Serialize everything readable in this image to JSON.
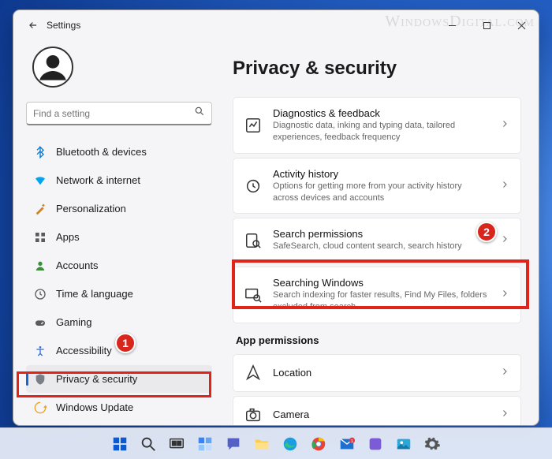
{
  "watermark": "WindowsDigital.com",
  "window": {
    "title": "Settings"
  },
  "search": {
    "placeholder": "Find a setting"
  },
  "sidebar": {
    "items": [
      {
        "label": "Bluetooth & devices",
        "icon": "bluetooth",
        "color": "#0078d4"
      },
      {
        "label": "Network & internet",
        "icon": "wifi",
        "color": "#00a4ef"
      },
      {
        "label": "Personalization",
        "icon": "brush",
        "color": "#c8852c"
      },
      {
        "label": "Apps",
        "icon": "apps",
        "color": "#5b5b5b"
      },
      {
        "label": "Accounts",
        "icon": "person",
        "color": "#3a8f3a"
      },
      {
        "label": "Time & language",
        "icon": "clock",
        "color": "#5b5b5b"
      },
      {
        "label": "Gaming",
        "icon": "game",
        "color": "#5b5b5b"
      },
      {
        "label": "Accessibility",
        "icon": "access",
        "color": "#2e6fd0"
      },
      {
        "label": "Privacy & security",
        "icon": "shield",
        "color": "#7a7f86",
        "active": true
      },
      {
        "label": "Windows Update",
        "icon": "update",
        "color": "#f0a020"
      }
    ]
  },
  "main": {
    "heading": "Privacy & security",
    "cards": [
      {
        "icon": "diag",
        "title": "Diagnostics & feedback",
        "subtitle": "Diagnostic data, inking and typing data, tailored experiences, feedback frequency"
      },
      {
        "icon": "activity",
        "title": "Activity history",
        "subtitle": "Options for getting more from your activity history across devices and accounts"
      },
      {
        "icon": "searchperm",
        "title": "Search permissions",
        "subtitle": "SafeSearch, cloud content search, search history"
      },
      {
        "icon": "searchwin",
        "title": "Searching Windows",
        "subtitle": "Search indexing for faster results, Find My Files, folders excluded from search"
      }
    ],
    "section_label": "App permissions",
    "perm_cards": [
      {
        "icon": "location",
        "title": "Location"
      },
      {
        "icon": "camera",
        "title": "Camera"
      }
    ]
  },
  "annotations": {
    "badge1": "1",
    "badge2": "2"
  }
}
